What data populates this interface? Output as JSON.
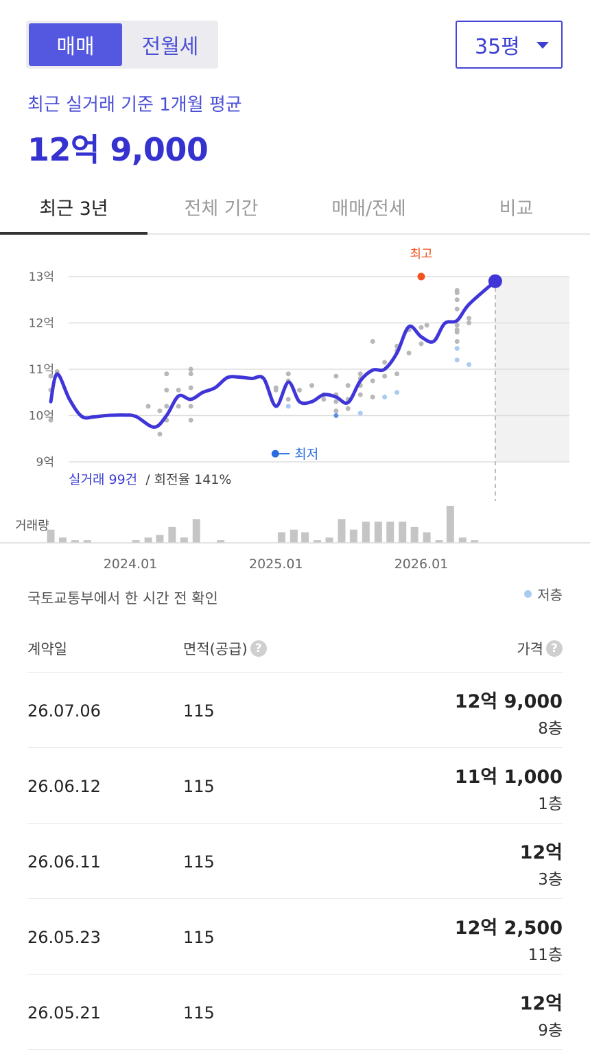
{
  "trade_type": {
    "sale": "매매",
    "rent": "전월세"
  },
  "size_select": {
    "value": "35평"
  },
  "summary": {
    "label": "최근 실거래 기준 1개월 평균",
    "value": "12억 9,000"
  },
  "tabs": [
    {
      "label": "최근 3년"
    },
    {
      "label": "전체 기간"
    },
    {
      "label": "매매/전세"
    },
    {
      "label": "비교"
    }
  ],
  "chart_data": {
    "type": "line",
    "y_unit": "억",
    "ylim": [
      9,
      13
    ],
    "yticks": [
      "13억",
      "12억",
      "11억",
      "10억",
      "9억"
    ],
    "xticks": [
      "2024.01",
      "2025.01",
      "2026.01"
    ],
    "x_range": [
      "2023.06",
      "2026.07"
    ],
    "marker_high": "최고",
    "marker_low": "최저",
    "deals_label": "실거래 99건",
    "turnover_label": "/ 회전율 141%",
    "volume_label": "거래량",
    "series": [
      {
        "values": [
          [
            "2023.06.15",
            10.3
          ],
          [
            "2023.07.01",
            10.9
          ],
          [
            "2023.08.01",
            10.35
          ],
          [
            "2023.09.01",
            9.98
          ],
          [
            "2023.10.01",
            9.97
          ],
          [
            "2023.11.01",
            10.0
          ],
          [
            "2023.12.15",
            10.01
          ],
          [
            "2024.01.15",
            9.98
          ],
          [
            "2024.03.01",
            9.75
          ],
          [
            "2024.04.01",
            10.0
          ],
          [
            "2024.05.01",
            10.42
          ],
          [
            "2024.06.01",
            10.35
          ],
          [
            "2024.07.01",
            10.5
          ],
          [
            "2024.08.01",
            10.6
          ],
          [
            "2024.09.01",
            10.82
          ],
          [
            "2024.10.01",
            10.83
          ],
          [
            "2024.11.01",
            10.8
          ],
          [
            "2024.12.01",
            10.8
          ],
          [
            "2025.01.01",
            10.2
          ],
          [
            "2025.02.01",
            10.72
          ],
          [
            "2025.03.01",
            10.3
          ],
          [
            "2025.04.01",
            10.3
          ],
          [
            "2025.05.01",
            10.45
          ],
          [
            "2025.06.01",
            10.4
          ],
          [
            "2025.07.01",
            10.28
          ],
          [
            "2025.08.01",
            10.75
          ],
          [
            "2025.09.01",
            10.98
          ],
          [
            "2025.10.01",
            11.0
          ],
          [
            "2025.11.01",
            11.35
          ],
          [
            "2025.12.01",
            11.92
          ],
          [
            "2026.01.01",
            11.7
          ],
          [
            "2026.02.01",
            11.6
          ],
          [
            "2026.03.01",
            11.99
          ],
          [
            "2026.04.01",
            12.05
          ],
          [
            "2026.05.01",
            12.4
          ],
          [
            "2026.07.06",
            12.9
          ]
        ]
      }
    ],
    "deals": [
      [
        "2023.06.15",
        9.9
      ],
      [
        "2023.06.15",
        10.55
      ],
      [
        "2023.06.15",
        10.85
      ],
      [
        "2023.07.01",
        10.95
      ],
      [
        "2024.02.15",
        10.2
      ],
      [
        "2024.03.15",
        10.1
      ],
      [
        "2024.03.15",
        9.6
      ],
      [
        "2024.04.01",
        10.9
      ],
      [
        "2024.04.01",
        10.55
      ],
      [
        "2024.04.01",
        10.2
      ],
      [
        "2024.04.01",
        9.9
      ],
      [
        "2024.05.01",
        10.55
      ],
      [
        "2024.05.01",
        10.2
      ],
      [
        "2024.06.01",
        11.0
      ],
      [
        "2024.06.01",
        10.9
      ],
      [
        "2024.06.01",
        10.6
      ],
      [
        "2024.06.01",
        10.2
      ],
      [
        "2024.06.01",
        9.9
      ],
      [
        "2025.01.01",
        10.55
      ],
      [
        "2025.01.01",
        10.6
      ],
      [
        "2025.02.01",
        10.9
      ],
      [
        "2025.02.01",
        10.75
      ],
      [
        "2025.02.01",
        10.35
      ],
      [
        "2025.03.01",
        10.55
      ],
      [
        "2025.04.01",
        10.65
      ],
      [
        "2025.05.01",
        10.45
      ],
      [
        "2025.05.01",
        10.35
      ],
      [
        "2025.06.01",
        10.85
      ],
      [
        "2025.06.01",
        10.45
      ],
      [
        "2025.06.01",
        10.3
      ],
      [
        "2025.06.01",
        10.1
      ],
      [
        "2025.07.01",
        10.65
      ],
      [
        "2025.07.01",
        10.35
      ],
      [
        "2025.07.01",
        10.15
      ],
      [
        "2025.08.01",
        10.9
      ],
      [
        "2025.08.01",
        10.8
      ],
      [
        "2025.08.01",
        10.45
      ],
      [
        "2025.08.01",
        10.65
      ],
      [
        "2025.09.01",
        11.6
      ],
      [
        "2025.09.01",
        10.75
      ],
      [
        "2025.09.01",
        10.4
      ],
      [
        "2025.10.01",
        10.85
      ],
      [
        "2025.10.01",
        11.15
      ],
      [
        "2025.11.01",
        11.5
      ],
      [
        "2025.11.01",
        10.9
      ],
      [
        "2025.11.01",
        11.4
      ],
      [
        "2025.12.01",
        11.35
      ],
      [
        "2025.12.01",
        11.85
      ],
      [
        "2026.01.01",
        11.55
      ],
      [
        "2026.01.01",
        11.9
      ],
      [
        "2026.01.15",
        11.95
      ],
      [
        "2026.04.01",
        12.7
      ],
      [
        "2026.04.01",
        12.65
      ],
      [
        "2026.04.01",
        12.5
      ],
      [
        "2026.04.01",
        12.3
      ],
      [
        "2026.04.01",
        11.95
      ],
      [
        "2026.04.01",
        11.85
      ],
      [
        "2026.04.01",
        11.6
      ],
      [
        "2026.04.01",
        11.8
      ],
      [
        "2026.05.01",
        12.1
      ],
      [
        "2026.05.01",
        12.0
      ]
    ],
    "low_floor_deals": [
      [
        "2025.02.01",
        10.2
      ],
      [
        "2025.08.01",
        10.05
      ],
      [
        "2025.10.01",
        10.4
      ],
      [
        "2025.11.01",
        10.5
      ],
      [
        "2026.04.01",
        11.45
      ],
      [
        "2026.04.01",
        11.2
      ],
      [
        "2026.05.01",
        11.1
      ]
    ],
    "low_floor_low_deals": [
      [
        "2025.06.01",
        10.0
      ]
    ],
    "volume_dates": [
      "2023.06.15",
      "2023.07.15",
      "2023.08.15",
      "2023.09.15",
      "2024.01.15",
      "2024.02.15",
      "2024.03.15",
      "2024.04.15",
      "2024.05.15",
      "2024.06.15",
      "2024.08.15",
      "2025.01.15",
      "2025.02.15",
      "2025.03.15",
      "2025.04.15",
      "2025.05.15",
      "2025.06.15",
      "2025.07.15",
      "2025.08.15",
      "2025.09.15",
      "2025.10.15",
      "2025.11.15",
      "2025.12.15",
      "2026.01.15",
      "2026.02.15",
      "2026.03.15",
      "2026.04.15",
      "2026.05.15",
      "2026.06.15"
    ],
    "volume": [
      5,
      2,
      1,
      1,
      1,
      2,
      3,
      6,
      2,
      9,
      1,
      4,
      5,
      4,
      1,
      2,
      9,
      5,
      8,
      8,
      8,
      8,
      6,
      4,
      1,
      14,
      2,
      1,
      0
    ],
    "high_point": [
      "2026.01.01",
      13.0
    ],
    "low_point": [
      "2025.01.01",
      9.25
    ],
    "latest": [
      "2026.07.06",
      12.9
    ],
    "colors": {
      "line": "#4036d8",
      "deal": "#b8b8b8",
      "deal_low_floor": "#a9cbf1",
      "high": "#f2541f",
      "low": "#2b6de0",
      "volume": "#c5c5c5"
    }
  },
  "source_text": "국토교통부에서 한 시간 전 확인",
  "legend_low_floor": "저층",
  "table": {
    "headers": {
      "date": "계약일",
      "area": "면적(공급)",
      "price": "가격"
    },
    "help_icon_glyph": "?",
    "rows": [
      {
        "date": "26.07.06",
        "area": "115",
        "price": "12억 9,000",
        "floor": "8층"
      },
      {
        "date": "26.06.12",
        "area": "115",
        "price": "11억 1,000",
        "floor": "1층"
      },
      {
        "date": "26.06.11",
        "area": "115",
        "price": "12억",
        "floor": "3층"
      },
      {
        "date": "26.05.23",
        "area": "115",
        "price": "12억 2,500",
        "floor": "11층"
      },
      {
        "date": "26.05.21",
        "area": "115",
        "price": "12억",
        "floor": "9층"
      }
    ]
  }
}
